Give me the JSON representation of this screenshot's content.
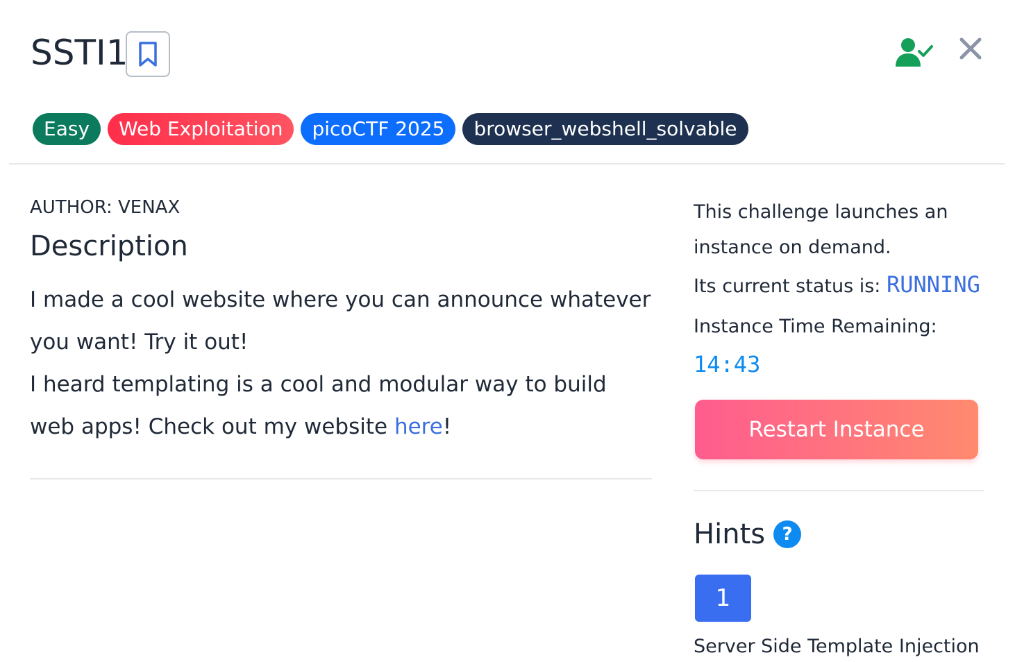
{
  "header": {
    "title": "SSTI1",
    "tags": [
      {
        "label": "Easy",
        "color": "#0b7a5d"
      },
      {
        "label": "Web Exploitation",
        "color": "#ff3b50"
      },
      {
        "label": "picoCTF 2025",
        "color": "#0d6efd"
      },
      {
        "label": "browser_webshell_solvable",
        "color": "#1e3150"
      }
    ],
    "icons": {
      "bookmark": "bookmark-icon",
      "user_status": "user-check-icon",
      "close": "close-icon"
    }
  },
  "main": {
    "author": "AUTHOR: VENAX",
    "description_title": "Description",
    "description_line1": "I made a cool website where you can announce whatever you want! Try it out!",
    "description_line2_prefix": "I heard templating is a cool and modular way to build web apps! Check out my website ",
    "description_link": "here",
    "description_line2_suffix": "!"
  },
  "instance": {
    "info": "This challenge launches an instance on demand.",
    "status_label": "Its current status is: ",
    "status_value": "RUNNING",
    "time_label": "Instance Time Remaining:",
    "time_value": "14:43",
    "restart_label": "Restart Instance"
  },
  "hints": {
    "title": "Hints",
    "help_symbol": "?",
    "items": [
      {
        "number": "1",
        "text": "Server Side Template Injection"
      }
    ]
  },
  "colors": {
    "accent_blue": "#3b6fe0",
    "timer_blue": "#0d8bf0",
    "success_green": "#15a05a"
  }
}
